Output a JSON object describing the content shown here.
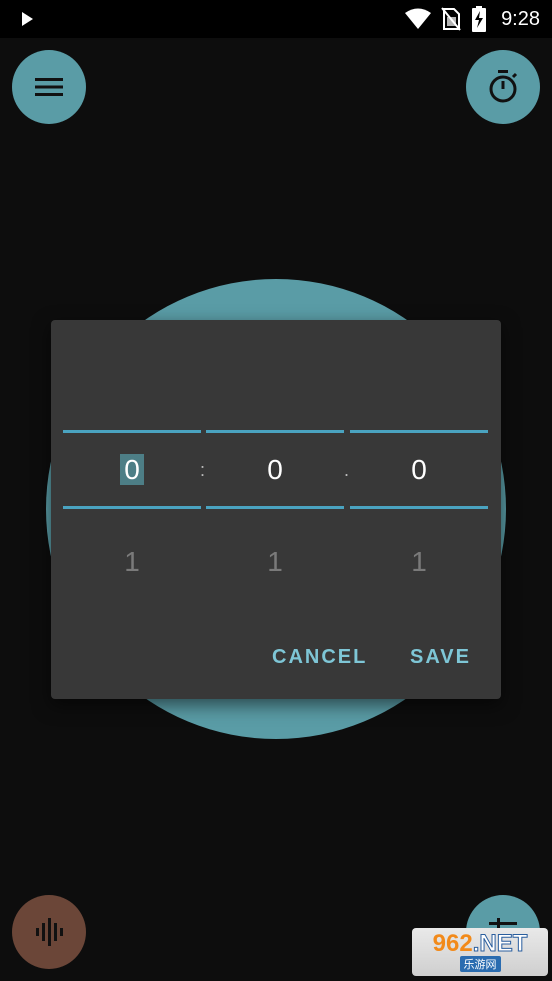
{
  "status_bar": {
    "time": "9:28",
    "icons": [
      "play-icon",
      "wifi-icon",
      "no-sim-icon",
      "battery-charging-icon"
    ]
  },
  "toolbar": {
    "menu_icon": "menu-icon",
    "timer_icon": "timer-icon"
  },
  "bottom": {
    "mic_icon": "audio-wave-icon",
    "tune_icon": "tune-icon",
    "mic_color": "#6b4638"
  },
  "accent_color": "#5a9ca6",
  "dialog": {
    "pickers": [
      {
        "name": "hours",
        "current": "0",
        "next": "1"
      },
      {
        "name": "minutes",
        "current": "0",
        "next": "1"
      },
      {
        "name": "seconds",
        "current": "0",
        "next": "1"
      }
    ],
    "separators": [
      ":",
      "."
    ],
    "cancel_label": "CANCEL",
    "save_label": "SAVE",
    "line_color": "#4aa3c0",
    "button_color": "#7ec6d6"
  },
  "watermark": {
    "top_a": "962",
    "top_b": ".NET",
    "bottom": "乐游网"
  }
}
